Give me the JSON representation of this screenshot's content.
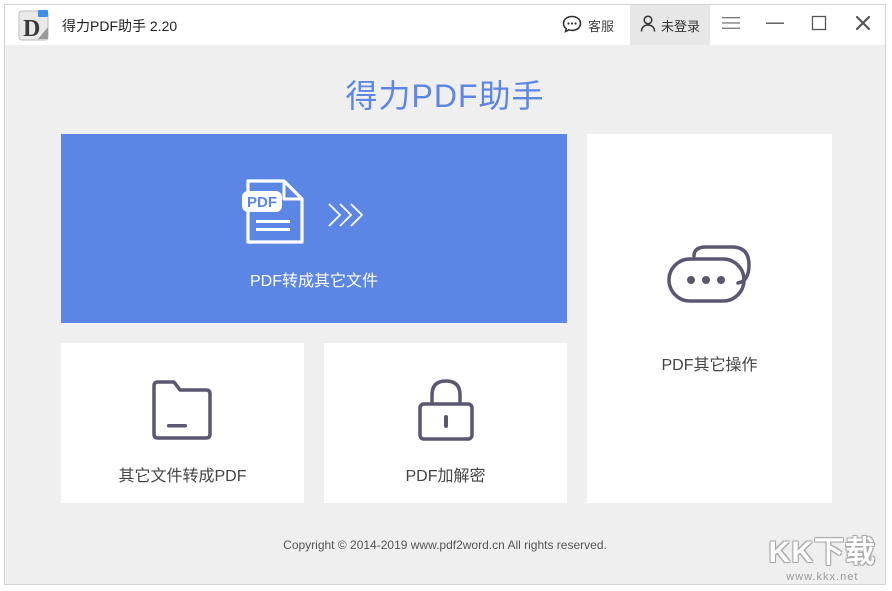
{
  "window": {
    "title": "得力PDF助手 2.20",
    "logo_letter": "D"
  },
  "toolbar": {
    "service_label": "客服",
    "login_label": "未登录",
    "menu_icon": "hamburger-menu-icon",
    "minimize_icon": "minimize-icon",
    "maximize_icon": "maximize-icon",
    "close_icon": "close-icon"
  },
  "main": {
    "title": "得力PDF助手",
    "cards": {
      "pdf_to_other": {
        "label": "PDF转成其它文件",
        "icon": "pdf-document-icon"
      },
      "other_to_pdf": {
        "label": "其它文件转成PDF",
        "icon": "folder-icon"
      },
      "encrypt": {
        "label": "PDF加解密",
        "icon": "lock-icon"
      },
      "other_ops": {
        "label": "PDF其它操作",
        "icon": "chat-bubbles-icon"
      }
    }
  },
  "footer": {
    "copyright": "Copyright © 2014-2019  www.pdf2word.cn  All rights reserved."
  },
  "watermark": {
    "logo": "KK下载",
    "url": "www.kkx.net"
  },
  "colors": {
    "accent": "#5b86e5",
    "background": "#efefef",
    "icon": "#5a5870"
  }
}
